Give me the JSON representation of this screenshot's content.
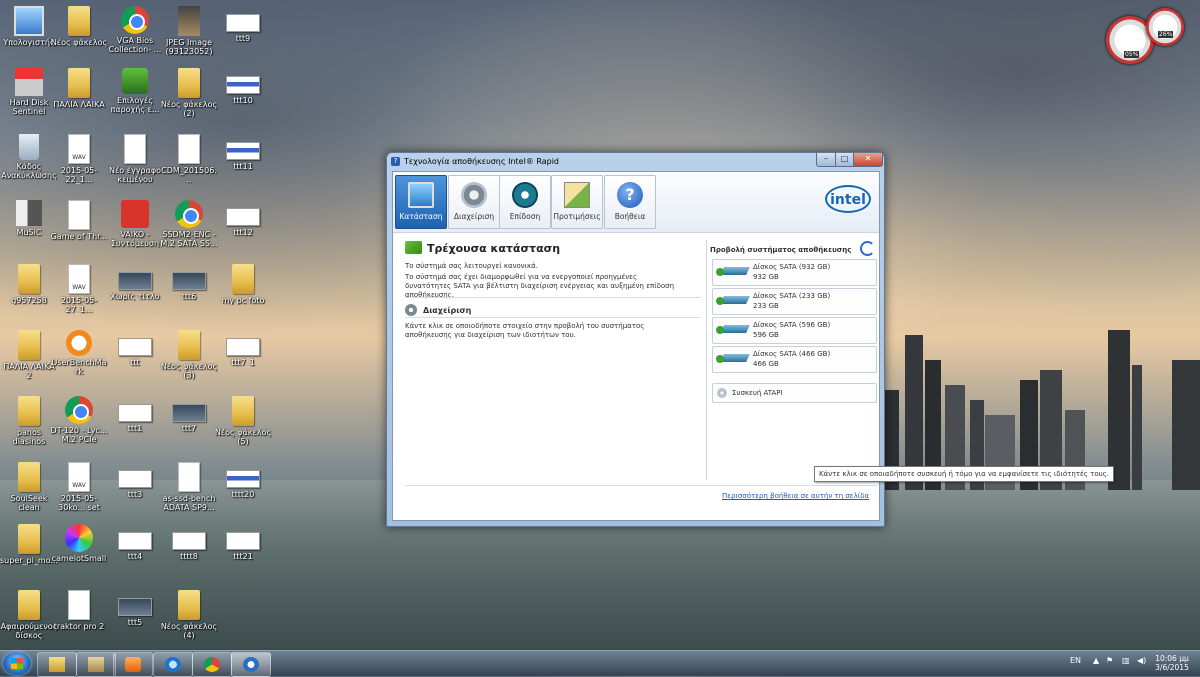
{
  "desktop": {
    "icons": [
      {
        "label": "Υπολογιστής"
      },
      {
        "label": "Νέος φάκελος"
      },
      {
        "label": "VGA Bios Collection- ..."
      },
      {
        "label": "JPEG Image (93123052)"
      },
      {
        "label": "ttt9"
      },
      {
        "label": "Hard Disk Sentinel"
      },
      {
        "label": "ΠΑΛΙΑ ΛΑΙΚΑ"
      },
      {
        "label": "Επιλογές παροχής ε..."
      },
      {
        "label": "Νέος φάκελος (2)"
      },
      {
        "label": "ttt10"
      },
      {
        "label": "Κάδος Ανακύκλωσης"
      },
      {
        "label": "2015-05-22_1..."
      },
      {
        "label": "Νέο έγγραφο κειμένου"
      },
      {
        "label": "CDM_201506..."
      },
      {
        "label": "ttt11"
      },
      {
        "label": "MuSiC"
      },
      {
        "label": "Game of Thr..."
      },
      {
        "label": "VAIKO - Συντόμευση"
      },
      {
        "label": "SSDM2-ENC - M.2 SATA SS..."
      },
      {
        "label": "ttt12"
      },
      {
        "label": "g957258"
      },
      {
        "label": "2015-05-27_1..."
      },
      {
        "label": "Χωρίς τίτλο"
      },
      {
        "label": "ttt6"
      },
      {
        "label": "my pc foto"
      },
      {
        "label": "ΠΑΛΙΑ ΛΑΙΚΑ 2"
      },
      {
        "label": "UserBenchMark"
      },
      {
        "label": "ttt"
      },
      {
        "label": "Νέος φάκελος (3)"
      },
      {
        "label": "ttt7_1"
      },
      {
        "label": "panos diasinos"
      },
      {
        "label": "DT-120 - Lyc... M.2 PCIe SSD..."
      },
      {
        "label": "ttt1"
      },
      {
        "label": "ttt7"
      },
      {
        "label": "Νέος φάκελος (5)"
      },
      {
        "label": "SoulSeek clean"
      },
      {
        "label": "2015-05-30ko... set .don't thi..."
      },
      {
        "label": "ttt3"
      },
      {
        "label": "as-ssd-bench ADATA SP9..."
      },
      {
        "label": "tttt20"
      },
      {
        "label": "super_pi_mo..."
      },
      {
        "label": "camelotSmall"
      },
      {
        "label": "ttt4"
      },
      {
        "label": "tttt8"
      },
      {
        "label": "ttt21"
      },
      {
        "label": "Αφαιρούμενος δίσκος"
      },
      {
        "label": "traktor pro 2"
      },
      {
        "label": "ttt5"
      },
      {
        "label": "Νέος φάκελος (4)"
      }
    ]
  },
  "gadget": {
    "cpu": "05%",
    "mem": "26%"
  },
  "window": {
    "title": "Τεχνολογία αποθήκευσης Intel® Rapid",
    "toolbar": [
      {
        "label": "Κατάσταση"
      },
      {
        "label": "Διαχείριση"
      },
      {
        "label": "Επίδοση"
      },
      {
        "label": "Προτιμήσεις"
      },
      {
        "label": "Βοήθεια"
      }
    ],
    "logo": "intel",
    "status": {
      "heading": "Τρέχουσα κατάσταση",
      "line1": "Το σύστημά σας λειτουργεί κανονικά.",
      "line2": "Το σύστημά σας έχει διαμορφωθεί για να ενεργοποιεί προηγμένες δυνατότητες SATA για βέλτιστη διαχείριση ενέργειας και αυξημένη επίδοση αποθήκευσης.",
      "manage_heading": "Διαχείριση",
      "manage_text": "Κάντε κλικ σε οποιοδήποτε στοιχείο στην προβολή του συστήματος αποθήκευσης για διαχείριση των ιδιοτήτων του."
    },
    "storage_view": {
      "heading": "Προβολή συστήματος αποθήκευσης",
      "disks": [
        {
          "name": "Δίσκος SATA (932 GB)",
          "size": "932 GB"
        },
        {
          "name": "Δίσκος SATA (233 GB)",
          "size": "233 GB"
        },
        {
          "name": "Δίσκος SATA (596 GB)",
          "size": "596 GB"
        },
        {
          "name": "Δίσκος SATA (466 GB)",
          "size": "466 GB"
        }
      ],
      "atapi": "Συσκευή ATAPI"
    },
    "help_link": "Περισσότερη βοήθεια σε αυτήν τη σελίδα",
    "tooltip": "Κάντε κλικ σε οποιαδήποτε συσκευή ή τόμο για να εμφανίσετε τις ιδιότητές τους."
  },
  "taskbar": {
    "lang": "EN",
    "time": "10:06 μμ",
    "date": "3/6/2015"
  }
}
